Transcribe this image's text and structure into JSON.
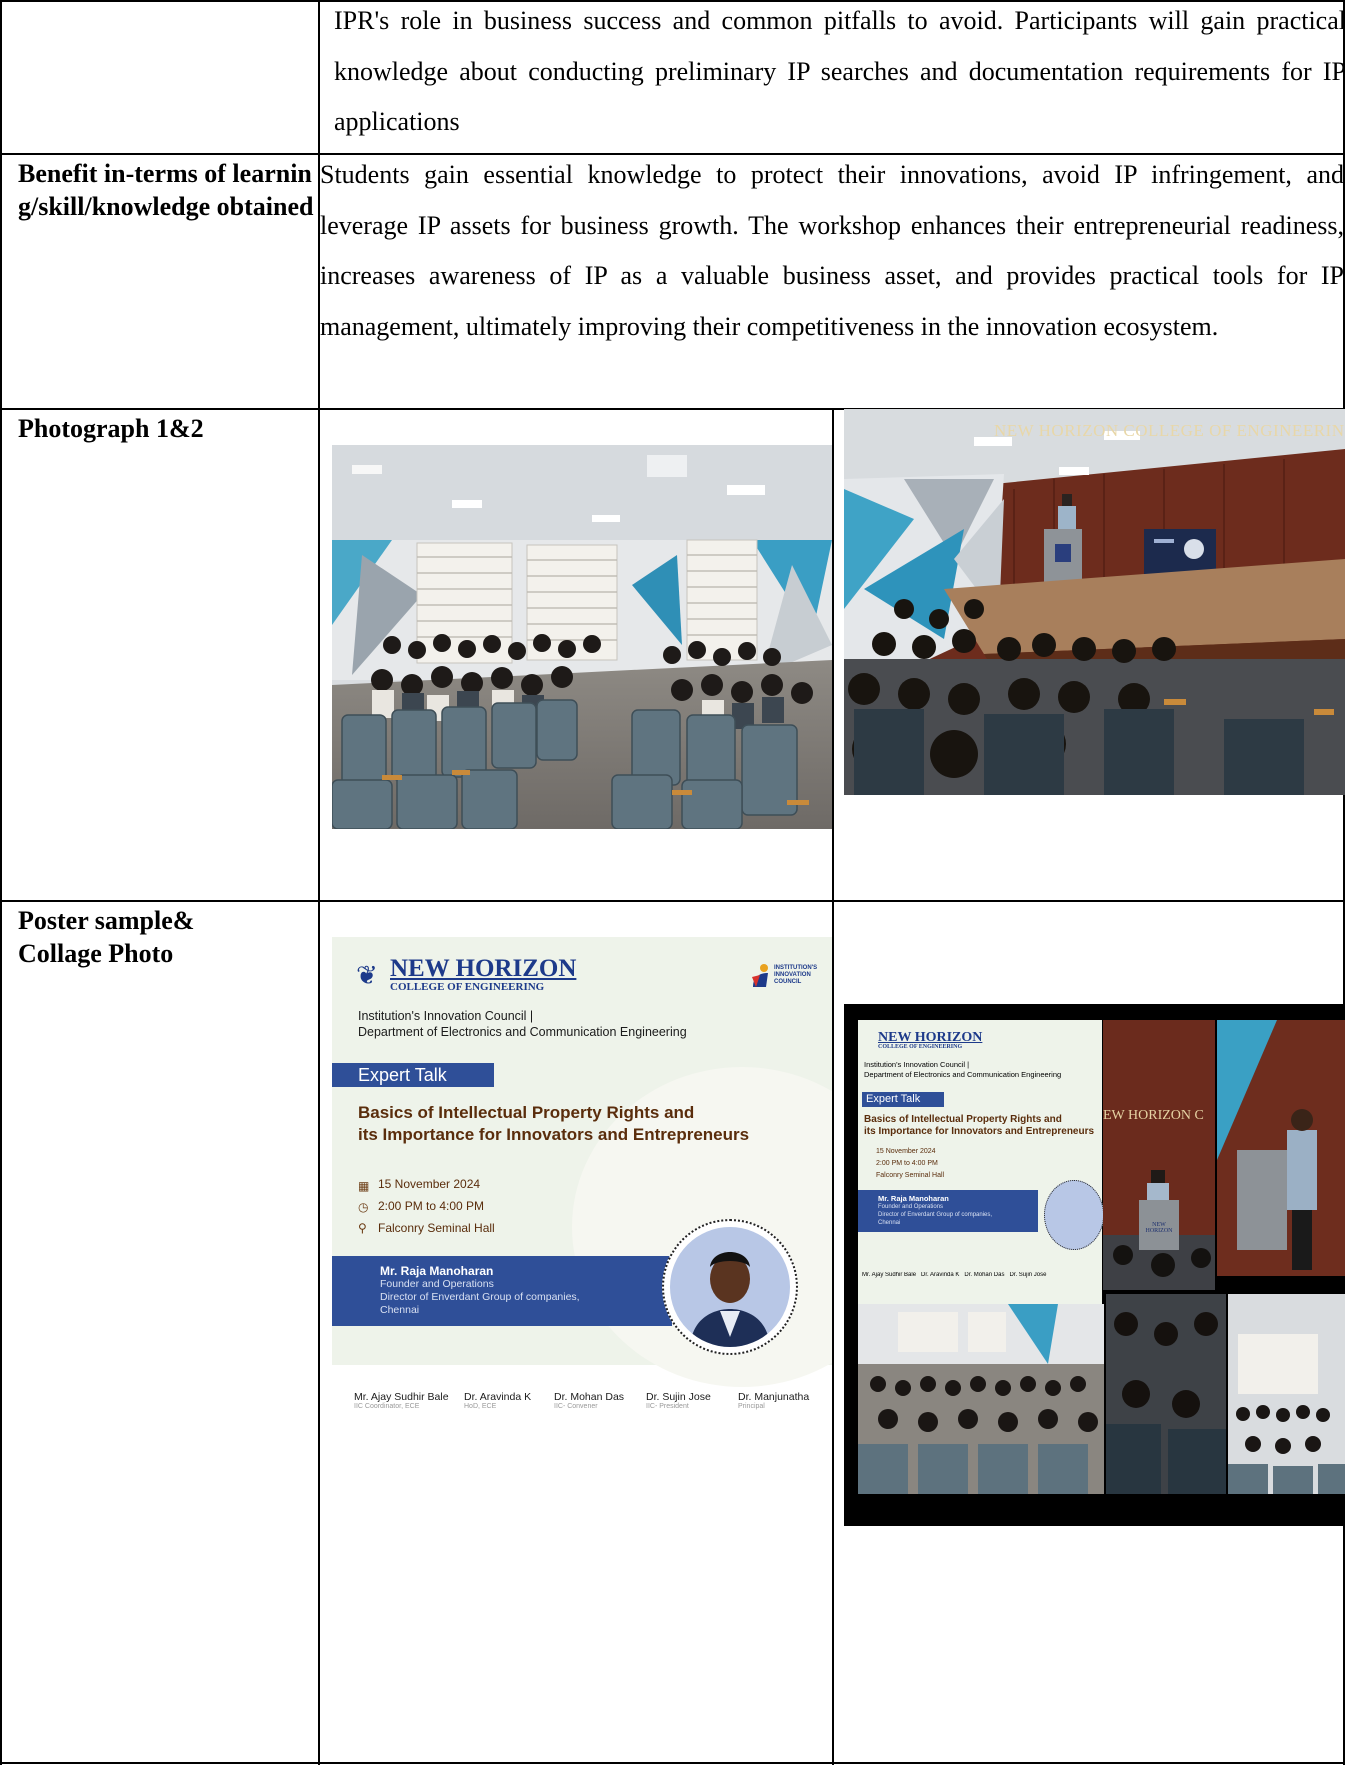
{
  "row1": {
    "text": "IPR's role in business success and common pitfalls to avoid. Participants will gain practical knowledge about conducting preliminary IP searches and documentation requirements for IP applications"
  },
  "row2": {
    "label": "Benefit in-terms of learning/skill/knowledge obtained",
    "text": "Students gain essential knowledge to protect their innovations, avoid IP infringement, and leverage IP assets for business growth. The workshop enhances their entrepreneurial readiness, increases awareness of IP as a valuable business asset, and provides practical tools for IP management, ultimately improving their competitiveness in the innovation ecosystem."
  },
  "row3": {
    "label": "Photograph 1&2",
    "photo2_sign": "NEW HORIZON COLLEGE OF ENGINEERING"
  },
  "row4": {
    "label_line1": "Poster sample&",
    "label_line2": "Collage Photo"
  },
  "poster": {
    "logo_main": "NEW HORIZON",
    "logo_sub": "COLLEGE OF ENGINEERING",
    "council_logo": "INSTITUTION'S INNOVATION COUNCIL",
    "dept_line1": "Institution's Innovation Council |",
    "dept_line2": "Department of Electronics and Communication Engineering",
    "event_type": "Expert Talk",
    "title_line1": "Basics of Intellectual Property Rights and",
    "title_line2": "its Importance for Innovators and Entrepreneurs",
    "date": "15 November 2024",
    "time": "2:00 PM to 4:00 PM",
    "venue": "Falconry Seminal Hall",
    "speaker_name": "Mr. Raja Manoharan",
    "speaker_role1": "Founder and Operations",
    "speaker_role2": "Director of Enverdant Group of companies,",
    "speaker_city": "Chennai",
    "footer": [
      {
        "name": "Mr. Ajay Sudhir Bale",
        "role": "IIC Coordinator, ECE"
      },
      {
        "name": "Dr. Aravinda K",
        "role": "HoD, ECE"
      },
      {
        "name": "Dr. Mohan Das",
        "role": "IIC- Convener"
      },
      {
        "name": "Dr. Sujin Jose",
        "role": "IIC- President"
      },
      {
        "name": "Dr. Manjunatha",
        "role": "Principal"
      }
    ]
  },
  "collage": {
    "sign": "EW HORIZON C",
    "podium": "NEW HORIZON"
  },
  "colors": {
    "border": "#000000",
    "poster_blue": "#2f4f98",
    "poster_bg": "#eef3ea",
    "wood": "#7a2f1c"
  }
}
